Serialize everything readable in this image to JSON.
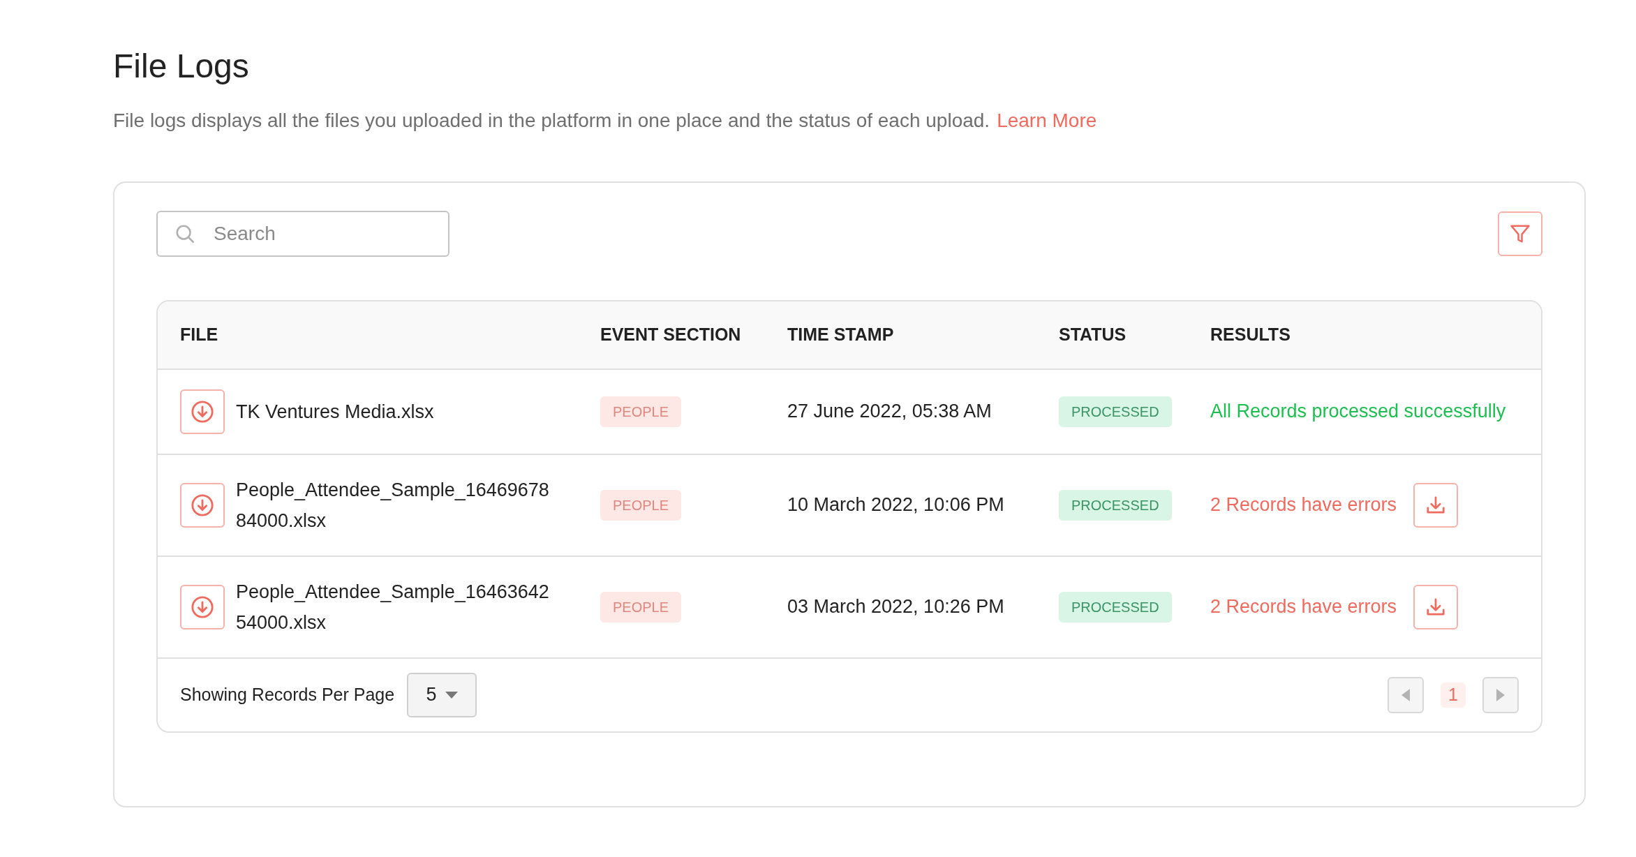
{
  "page": {
    "title": "File Logs",
    "description": "File logs displays all the files you uploaded in the platform in one place and the status of each upload.",
    "learn_more_link": "Learn More"
  },
  "search": {
    "placeholder": "Search"
  },
  "table": {
    "columns": [
      "FILE",
      "EVENT SECTION",
      "TIME STAMP",
      "STATUS",
      "RESULTS"
    ],
    "rows": [
      {
        "file": "TK Ventures Media.xlsx",
        "event_section": "PEOPLE",
        "time_stamp": "27 June 2022, 05:38 AM",
        "status": "PROCESSED",
        "result": {
          "kind": "success",
          "text": "All Records processed successfully"
        }
      },
      {
        "file": "People_Attendee_Sample_1646967884000.xlsx",
        "event_section": "PEOPLE",
        "time_stamp": "10 March 2022, 10:06 PM",
        "status": "PROCESSED",
        "result": {
          "kind": "error",
          "text": "2 Records have errors"
        }
      },
      {
        "file": "People_Attendee_Sample_1646364254000.xlsx",
        "event_section": "PEOPLE",
        "time_stamp": "03 March 2022, 10:26 PM",
        "status": "PROCESSED",
        "result": {
          "kind": "error",
          "text": "2 Records have errors"
        }
      }
    ]
  },
  "footer": {
    "per_page_label": "Showing Records Per Page",
    "per_page_value": "5",
    "pagination": {
      "prev_disabled": true,
      "next_disabled": true,
      "pages": [
        {
          "label": "1",
          "selected": true
        }
      ]
    }
  }
}
